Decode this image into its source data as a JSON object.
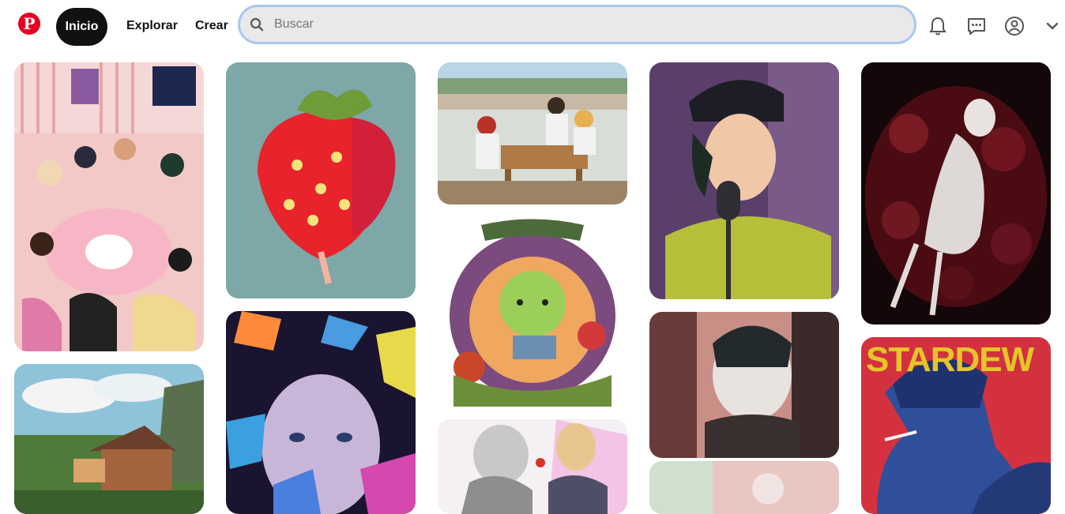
{
  "header": {
    "logo_icon": "pinterest-logo-icon",
    "logo_letter": "P",
    "brand_color": "#e60023",
    "nav": {
      "home": "Inicio",
      "explore": "Explorar",
      "create": "Crear"
    },
    "search": {
      "placeholder": "Buscar",
      "value": ""
    },
    "icons": [
      "bell-icon",
      "message-icon",
      "profile-icon",
      "chevron-down-icon"
    ]
  },
  "pins": {
    "p8": {
      "title": "STARDEW"
    }
  }
}
